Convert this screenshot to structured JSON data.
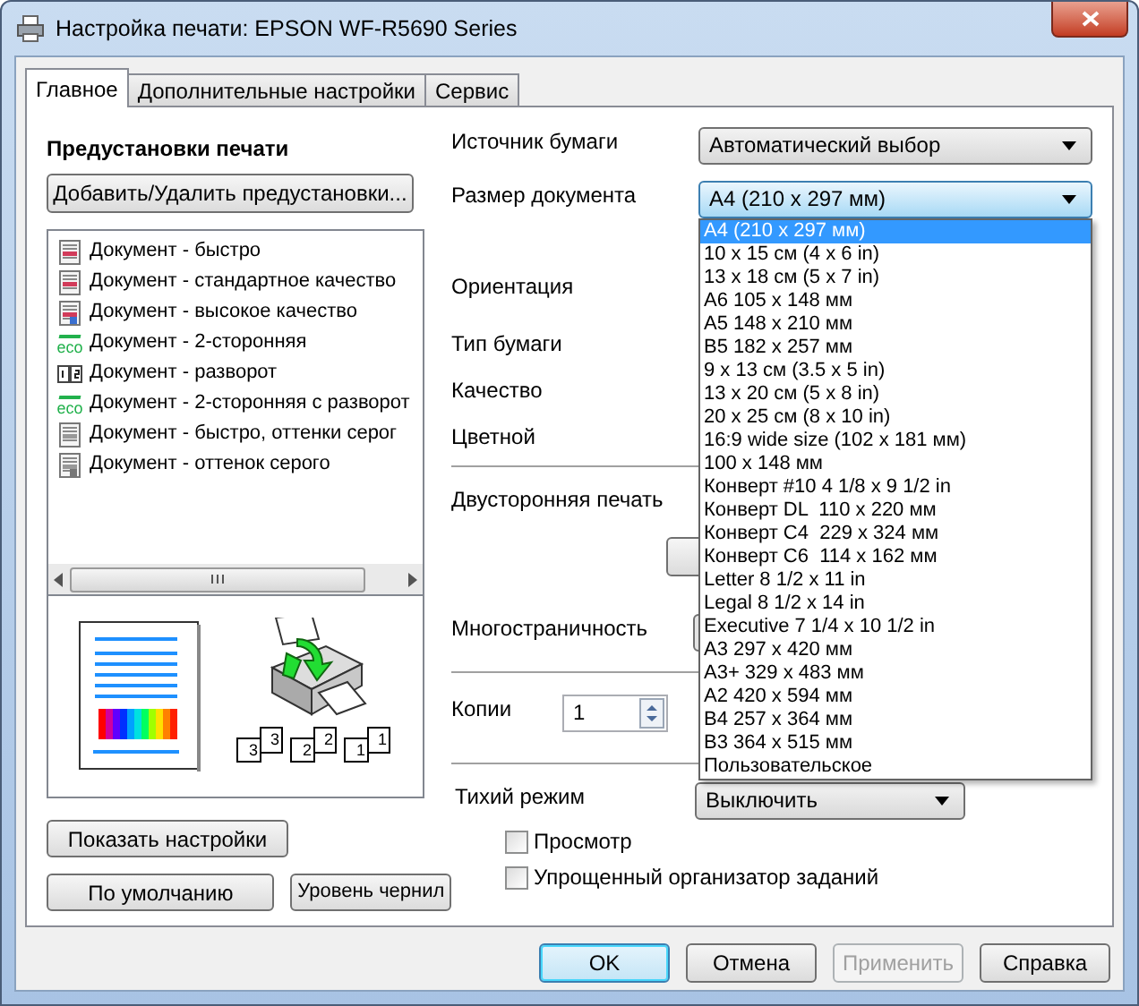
{
  "window": {
    "title": "Настройка печати: EPSON WF-R5690 Series"
  },
  "tabs": [
    {
      "label": "Главное",
      "selected": true
    },
    {
      "label": "Дополнительные настройки",
      "selected": false
    },
    {
      "label": "Сервис",
      "selected": false
    }
  ],
  "presets": {
    "title": "Предустановки печати",
    "add_button": "Добавить/Удалить предустановки...",
    "items": [
      {
        "kind": "doc",
        "label": "Документ - быстро"
      },
      {
        "kind": "doc",
        "label": "Документ - стандартное качество"
      },
      {
        "kind": "doc_hq",
        "label": "Документ - высокое качество"
      },
      {
        "kind": "eco",
        "badge": "eco",
        "label": "Документ - 2-сторонняя"
      },
      {
        "kind": "pages",
        "label": "Документ - разворот"
      },
      {
        "kind": "eco",
        "badge": "eco",
        "label": "Документ - 2-сторонняя с разворот"
      },
      {
        "kind": "gray",
        "label": "Документ - быстро, оттенки серог"
      },
      {
        "kind": "gray_hq",
        "label": "Документ - оттенок серого"
      }
    ]
  },
  "collate": [
    {
      "back": "3",
      "front": "3"
    },
    {
      "back": "2",
      "front": "2"
    },
    {
      "back": "1",
      "front": "1"
    }
  ],
  "left_buttons": [
    "Показать настройки",
    "По умолчанию",
    "Уровень чернил"
  ],
  "settings": {
    "paper_source": {
      "label": "Источник бумаги",
      "value": "Автоматический выбор"
    },
    "document_size": {
      "label": "Размер документа",
      "value": "A4 (210 x 297 мм)",
      "expanded": true,
      "options": [
        {
          "label": "A4 (210 x 297 мм)",
          "selected": true
        },
        {
          "label": "10 x 15 см (4 x 6 in)",
          "selected": false
        },
        {
          "label": "13 x 18 см (5 x 7 in)",
          "selected": false
        },
        {
          "label": "A6 105 x 148 мм",
          "selected": false
        },
        {
          "label": "A5 148 x 210 мм",
          "selected": false
        },
        {
          "label": "B5 182 x 257 мм",
          "selected": false
        },
        {
          "label": "9 x 13 см (3.5 x 5 in)",
          "selected": false
        },
        {
          "label": "13 x 20 см (5 x 8 in)",
          "selected": false
        },
        {
          "label": "20 x 25 см (8 x 10 in)",
          "selected": false
        },
        {
          "label": "16:9 wide size (102 x 181 мм)",
          "selected": false
        },
        {
          "label": "100 x 148 мм",
          "selected": false
        },
        {
          "label": "Конверт #10 4 1/8 x 9 1/2 in",
          "selected": false
        },
        {
          "label": "Конверт DL  110 x 220 мм",
          "selected": false
        },
        {
          "label": "Конверт C4  229 x 324 мм",
          "selected": false
        },
        {
          "label": "Конверт C6  114 x 162 мм",
          "selected": false
        },
        {
          "label": "Letter 8 1/2 x 11 in",
          "selected": false
        },
        {
          "label": "Legal 8 1/2 x 14 in",
          "selected": false
        },
        {
          "label": "Executive 7 1/4 x 10 1/2 in",
          "selected": false
        },
        {
          "label": "A3 297 x 420 мм",
          "selected": false
        },
        {
          "label": "A3+ 329 x 483 мм",
          "selected": false
        },
        {
          "label": "A2 420 x 594 мм",
          "selected": false
        },
        {
          "label": "B4 257 x 364 мм",
          "selected": false
        },
        {
          "label": "B3 364 x 515 мм",
          "selected": false
        },
        {
          "label": "Пользовательское",
          "selected": false
        }
      ]
    },
    "orientation": {
      "label": "Ориентация"
    },
    "paper_type": {
      "label": "Тип бумаги"
    },
    "quality": {
      "label": "Качество"
    },
    "color": {
      "label": "Цветной"
    },
    "duplex": {
      "label": "Двусторонняя печать"
    },
    "multipage": {
      "label": "Многостраничность"
    },
    "copies": {
      "label": "Копии",
      "value": "1"
    },
    "quiet_mode": {
      "label": "Тихий режим",
      "value": "Выключить"
    },
    "checkboxes": [
      {
        "label": "Просмотр",
        "checked": false
      },
      {
        "label": "Упрощенный организатор заданий",
        "checked": false
      }
    ]
  },
  "footer_buttons": [
    {
      "label": "OK",
      "default": true,
      "disabled": false
    },
    {
      "label": "Отмена",
      "default": false,
      "disabled": false
    },
    {
      "label": "Применить",
      "default": false,
      "disabled": true
    },
    {
      "label": "Справка",
      "default": false,
      "disabled": false
    }
  ]
}
